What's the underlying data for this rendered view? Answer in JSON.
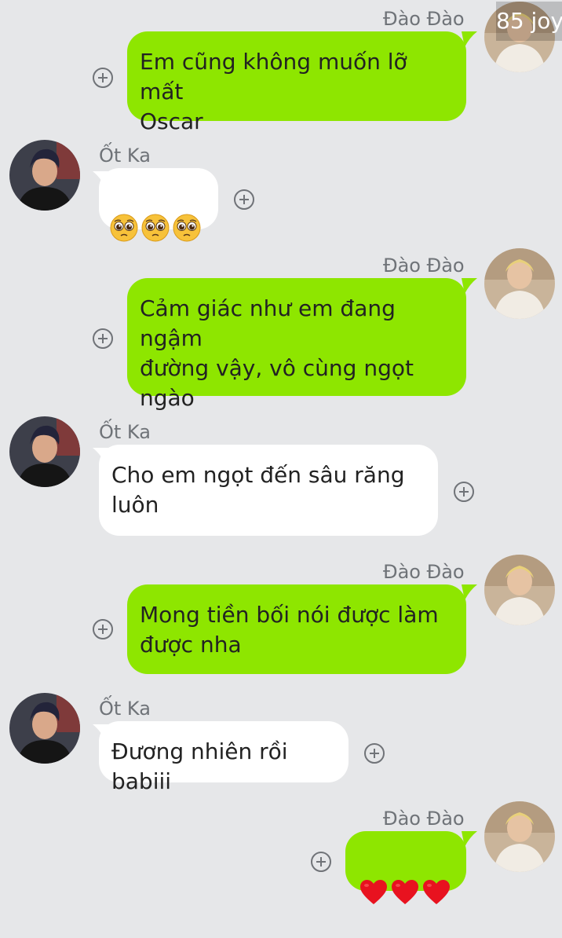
{
  "contacts": {
    "self_name": "Đào Đào",
    "other_name": "Ốt Ka"
  },
  "watermark": "85 joy",
  "colors": {
    "background": "#e6e7e9",
    "sent_bubble": "#8ee600",
    "received_bubble": "#ffffff",
    "sender_name": "#6f7378",
    "heart": "#e8121f"
  },
  "messages": [
    {
      "sender": "Đào Đào",
      "direction": "sent",
      "text": "Em cũng không muốn lỡ mất\nOscar"
    },
    {
      "sender": "Ốt Ka",
      "direction": "received",
      "emoji": [
        "pleading-face-icon",
        "pleading-face-icon",
        "pleading-face-icon"
      ]
    },
    {
      "sender": "Đào Đào",
      "direction": "sent",
      "text": "Cảm giác như em đang ngậm\nđường vậy, vô cùng ngọt\nngào"
    },
    {
      "sender": "Ốt Ka",
      "direction": "received",
      "text": "Cho em ngọt đến sâu răng\nluôn"
    },
    {
      "sender": "Đào Đào",
      "direction": "sent",
      "text": "Mong tiền bối nói được làm\nđược nha"
    },
    {
      "sender": "Ốt Ka",
      "direction": "received",
      "text": "Đương nhiên rồi babiii"
    },
    {
      "sender": "Đào Đào",
      "direction": "sent",
      "emoji": [
        "red-heart-icon",
        "red-heart-icon",
        "red-heart-icon"
      ]
    }
  ]
}
